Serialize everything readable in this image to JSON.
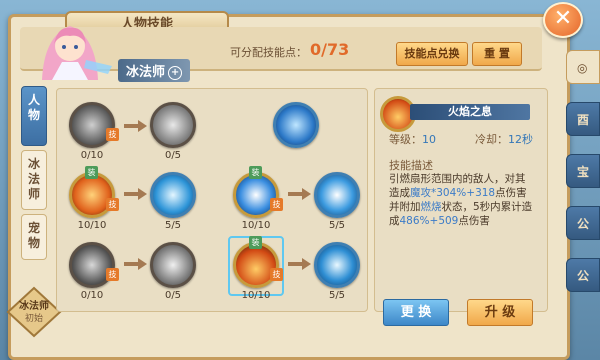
{
  "window": {
    "title": "人物技能",
    "close_icon": "close-icon"
  },
  "header": {
    "class_name": "冰法师",
    "points_label": "可分配技能点：",
    "points_value": "0/73",
    "exchange_label": "技能点兑换",
    "reset_label": "重 置"
  },
  "side_tabs": [
    {
      "label": "人\n物",
      "active": true
    },
    {
      "label": "冰\n法\n师",
      "active": false
    },
    {
      "label": "宠\n物",
      "active": false
    }
  ],
  "bottom_badge": {
    "line1": "冰法师",
    "line2": "初始"
  },
  "tree": {
    "badges": {
      "ji": "技",
      "zhuang": "装"
    },
    "nodes": [
      {
        "count": "0/10",
        "icon": "claw-slash-icon"
      },
      {
        "count": "0/5",
        "icon": "arrow-burst-icon"
      },
      {
        "count": "",
        "icon": "water-orb-icon"
      },
      {
        "count": "10/10",
        "icon": "fire-burst-icon"
      },
      {
        "count": "5/5",
        "icon": "ice-swirl-icon"
      },
      {
        "count": "10/10",
        "icon": "frost-star-icon"
      },
      {
        "count": "5/5",
        "icon": "frost-nova-icon"
      },
      {
        "count": "0/10",
        "icon": "shadow-strike-icon"
      },
      {
        "count": "0/5",
        "icon": "wind-slash-icon"
      },
      {
        "count": "10/10",
        "icon": "flame-wall-icon"
      },
      {
        "count": "5/5",
        "icon": "ice-ring-icon"
      }
    ]
  },
  "detail": {
    "skill_name": "火焰之息",
    "level_label": "等级：",
    "level_value": "10",
    "cooldown_label": "冷却：",
    "cooldown_value": "12秒",
    "desc_title": "技能描述",
    "desc_a": "引燃扇形范围内的敌人，对其造成",
    "desc_b": "魔攻*304%+318",
    "desc_c": "点伤害并附加",
    "desc_d": "燃烧",
    "desc_e": "状态，5秒内累计造成",
    "desc_f": "486%+509",
    "desc_g": "点伤害"
  },
  "buttons": {
    "swap": "更 换",
    "upgrade": "升 级"
  },
  "right_tabs": [
    "",
    "酉",
    "宝",
    "公",
    "公"
  ]
}
